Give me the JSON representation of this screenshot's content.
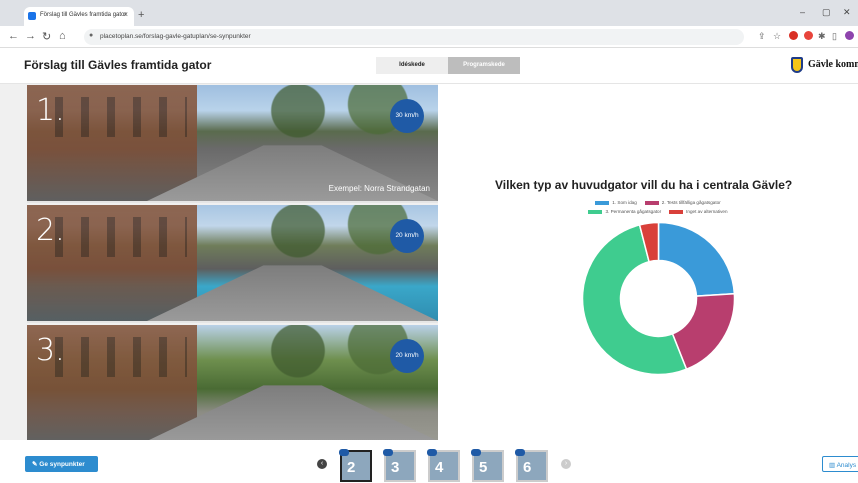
{
  "browser": {
    "tab_title": "Förslag till Gävles framtida gator",
    "tab_close": "×",
    "new_tab": "+",
    "url": "placetoplan.se/forslag-gavle-gatuplan/se-synpunkter",
    "win_min": "–",
    "win_max": "▢",
    "win_close": "✕",
    "back": "←",
    "forward": "→",
    "reload": "↻",
    "home": "⌂"
  },
  "header": {
    "title": "Förslag till Gävles framtida gator",
    "phases": [
      "Idéskede",
      "Programskede"
    ],
    "brand": "Gävle kommun"
  },
  "photos": [
    {
      "number": "1.",
      "speed": "30 km/h",
      "caption": "Exempel: Norra Strandgatan"
    },
    {
      "number": "2.",
      "speed": "20 km/h",
      "caption": ""
    },
    {
      "number": "3.",
      "speed": "20 km/h",
      "caption": ""
    }
  ],
  "chart_data": {
    "type": "pie",
    "title": "Vilken typ av huvudgator vill du ha i centrala Gävle?",
    "labels": [
      "1. Som idag",
      "2. Tests tillfälliga gågatsgator",
      "3. Permanenta gågatsgator",
      "Inget av alternativen"
    ],
    "values": [
      24,
      20,
      52,
      4
    ],
    "colors": [
      "#3a9ad9",
      "#b83e6e",
      "#3fcc8f",
      "#d9403a"
    ]
  },
  "footer": {
    "opinion_button": "Ge synpunkter",
    "analysis_button": "Analys",
    "thumbnails": [
      "2",
      "3",
      "4",
      "5",
      "6"
    ],
    "prev": "‹",
    "next": "›"
  }
}
